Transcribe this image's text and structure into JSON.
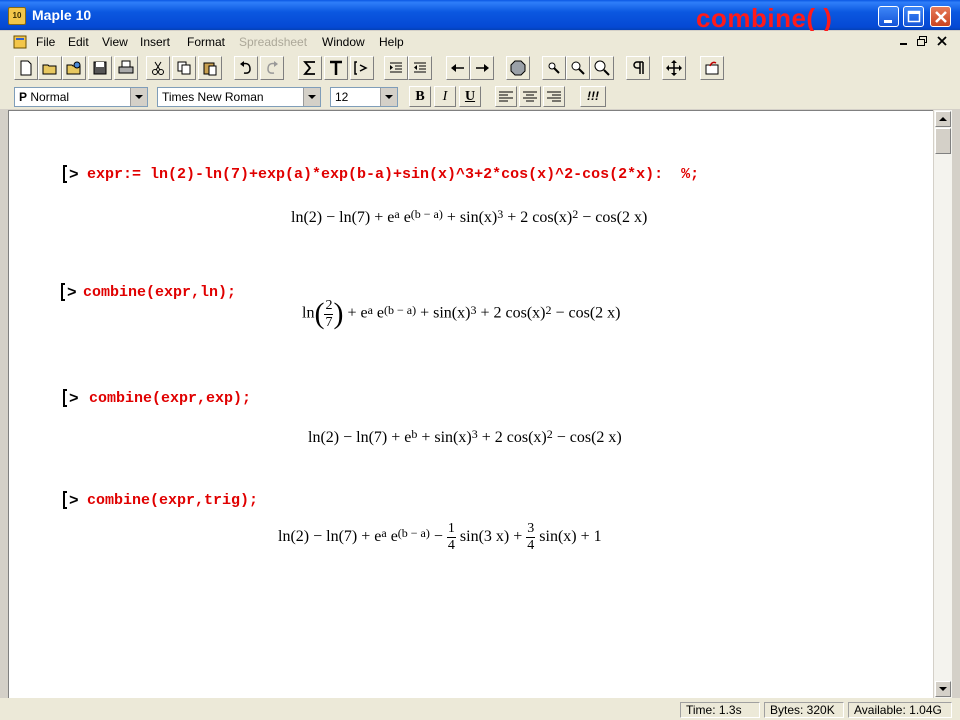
{
  "window": {
    "title": "Maple 10",
    "icon_label": "10",
    "overlay_title": "combine( )"
  },
  "menu": {
    "items": [
      {
        "label": "File",
        "enabled": true
      },
      {
        "label": "Edit",
        "enabled": true
      },
      {
        "label": "View",
        "enabled": true
      },
      {
        "label": "Insert",
        "enabled": true
      },
      {
        "label": "Format",
        "enabled": true
      },
      {
        "label": "Spreadsheet",
        "enabled": false
      },
      {
        "label": "Window",
        "enabled": true
      },
      {
        "label": "Help",
        "enabled": true
      }
    ]
  },
  "toolbar": {
    "buttons": [
      "new-icon",
      "open-icon",
      "open-url-icon",
      "save-icon",
      "print-icon",
      "cut-icon",
      "copy-icon",
      "paste-icon",
      "undo-icon",
      "redo-icon",
      "sigma-icon",
      "text-icon",
      "prompt-icon",
      "indent-icon",
      "outdent-icon",
      "back-icon",
      "forward-icon",
      "stop-icon",
      "zoom-100-icon",
      "zoom-200-icon",
      "zoom-400-icon",
      "pilcrow-icon",
      "expand-icon",
      "restart-icon"
    ],
    "prompt_label": "[>"
  },
  "format": {
    "style_prefix": "P",
    "style": "Normal",
    "font": "Times New Roman",
    "size": "12",
    "bold_label": "B",
    "italic_label": "I",
    "underline_label": "U",
    "execute_label": "!!!"
  },
  "worksheet": {
    "prompt_symbol": ">",
    "groups": [
      {
        "command": "expr:= ln(2)-ln(7)+exp(a)*exp(b-a)+sin(x)^3+2*cos(x)^2-cos(2*x):  %;",
        "output": {
          "p1": "ln(2) − ln(7) + e",
          "e1": "a",
          "p2": " e",
          "e2": "(b − a)",
          "p3": " + sin(x)",
          "e3": "3",
          "p4": " + 2 cos(x)",
          "e4": "2",
          "p5": " − cos(2 x)"
        }
      },
      {
        "command": "combine(expr,ln);",
        "output": {
          "p0": "ln",
          "num": "2",
          "den": "7",
          "p1": " + e",
          "e1": "a",
          "p2": " e",
          "e2": "(b − a)",
          "p3": " + sin(x)",
          "e3": "3",
          "p4": " + 2 cos(x)",
          "e4": "2",
          "p5": " − cos(2 x)"
        }
      },
      {
        "command": "combine(expr,exp);",
        "output": {
          "p1": "ln(2) − ln(7) + e",
          "e1": "b",
          "p2": " + sin(x)",
          "e2": "3",
          "p3": " + 2 cos(x)",
          "e3": "2",
          "p4": " − cos(2 x)"
        }
      },
      {
        "command": "combine(expr,trig);",
        "output": {
          "p1": "ln(2) − ln(7) + e",
          "e1": "a",
          "p2": " e",
          "e2": "(b − a)",
          "p3": " − ",
          "n1": "1",
          "d1": "4",
          "p4": " sin(3 x) + ",
          "n2": "3",
          "d2": "4",
          "p5": " sin(x) + 1"
        }
      }
    ]
  },
  "status": {
    "time": "Time:   1.3s",
    "bytes": "Bytes:  320K",
    "available": "Available:  1.04G"
  },
  "colors": {
    "command_red": "#e00000",
    "overlay_red": "#ff1a1a",
    "titlebar_blue": "#0a57e3"
  }
}
